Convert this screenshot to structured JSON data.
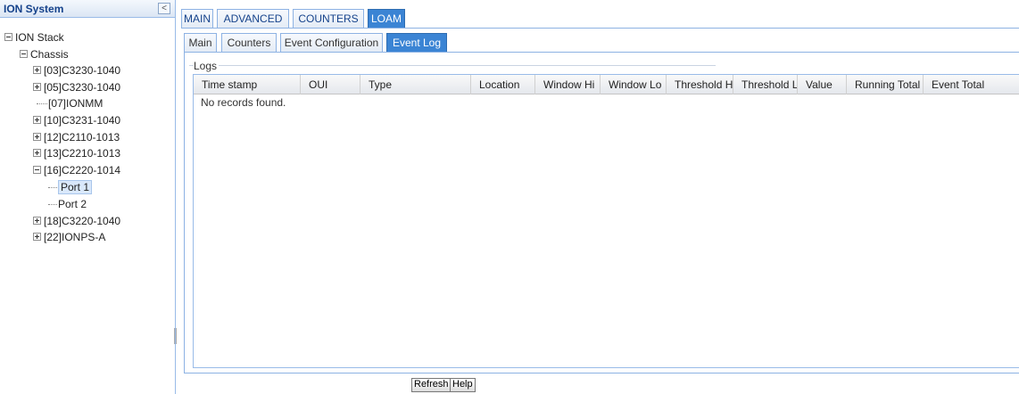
{
  "left_panel": {
    "title": "ION System",
    "collapse_glyph": "<",
    "tree": [
      {
        "label": "ION Stack",
        "toggle": "minus"
      },
      {
        "label": "Chassis",
        "toggle": "minus"
      },
      {
        "label": "[03]C3230-1040",
        "toggle": "plus"
      },
      {
        "label": "[05]C3230-1040",
        "toggle": "plus"
      },
      {
        "label": "[07]IONMM",
        "toggle": "leaf"
      },
      {
        "label": "[10]C3231-1040",
        "toggle": "plus"
      },
      {
        "label": "[12]C2110-1013",
        "toggle": "plus"
      },
      {
        "label": "[13]C2210-1013",
        "toggle": "plus"
      },
      {
        "label": "[16]C2220-1014",
        "toggle": "minus"
      },
      {
        "label": "Port 1",
        "toggle": "leaf",
        "selected": true
      },
      {
        "label": "Port 2",
        "toggle": "leaf"
      },
      {
        "label": "[18]C3220-1040",
        "toggle": "plus"
      },
      {
        "label": "[22]IONPS-A",
        "toggle": "plus"
      }
    ]
  },
  "main_tabs": {
    "items": [
      {
        "label": "MAIN"
      },
      {
        "label": "ADVANCED"
      },
      {
        "label": "COUNTERS"
      },
      {
        "label": "LOAM",
        "active": true
      }
    ]
  },
  "sub_tabs": {
    "items": [
      {
        "label": "Main"
      },
      {
        "label": "Counters"
      },
      {
        "label": "Event Configuration"
      },
      {
        "label": "Event Log",
        "active": true
      }
    ]
  },
  "logs": {
    "legend": "Logs",
    "columns": [
      "Time stamp",
      "OUI",
      "Type",
      "Location",
      "Window Hi",
      "Window Lo",
      "Threshold Hi",
      "Threshold Lo",
      "Value",
      "Running Total",
      "Event Total"
    ],
    "empty_message": "No records found."
  },
  "buttons": {
    "refresh": "Refresh",
    "help": "Help"
  },
  "colors": {
    "active_tab": "#3b84d4",
    "border": "#8db2e3"
  }
}
